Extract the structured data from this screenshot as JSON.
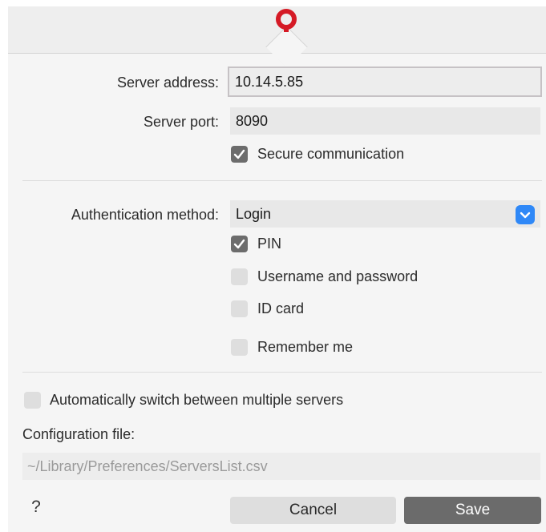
{
  "app": {
    "logo_icon": "q-logo-icon",
    "logo_color": "#d51a25"
  },
  "server": {
    "address_label": "Server address:",
    "address_value": "10.14.5.85",
    "port_label": "Server port:",
    "port_value": "8090",
    "secure_label": "Secure communication",
    "secure_checked": true
  },
  "auth": {
    "method_label": "Authentication method:",
    "method_value": "Login",
    "options": [
      {
        "label": "PIN",
        "checked": true
      },
      {
        "label": "Username and password",
        "checked": false
      },
      {
        "label": "ID card",
        "checked": false
      },
      {
        "label": "Remember me",
        "checked": false
      }
    ]
  },
  "multi": {
    "switch_label": "Automatically switch between multiple servers",
    "switch_checked": false,
    "config_label": "Configuration file:",
    "config_path": "~/Library/Preferences/ServersList.csv"
  },
  "footer": {
    "help_label": "?",
    "cancel_label": "Cancel",
    "save_label": "Save"
  },
  "colors": {
    "accent": "#2f88f7",
    "checkbox_on": "#6c6c6c",
    "save_button": "#6b6b6b"
  }
}
